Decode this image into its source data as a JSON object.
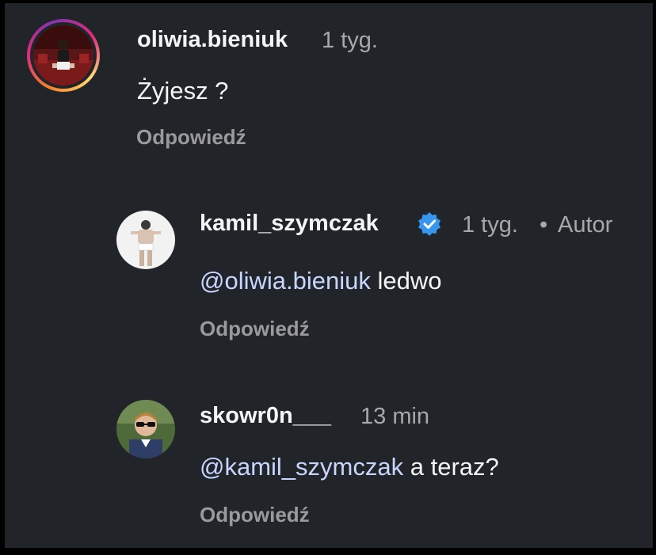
{
  "comments": [
    {
      "username": "oliwia.bieniuk",
      "time": "1 tyg.",
      "text": "Żyjesz ?",
      "reply_label": "Odpowiedź"
    },
    {
      "username": "kamil_szymczak",
      "verified_icon": "verified-badge-icon",
      "time": "1 tyg.",
      "separator": "•",
      "author_label": "Autor",
      "mention": "@oliwia.bieniuk",
      "text": "ledwo",
      "reply_label": "Odpowiedź"
    },
    {
      "username": "skowr0n___",
      "time": "13 min",
      "mention": "@kamil_szymczak",
      "text": "a teraz?",
      "reply_label": "Odpowiedź"
    }
  ],
  "colors": {
    "background": "#212529",
    "mention": "#c7d6ff",
    "verified": "#3797f0"
  }
}
